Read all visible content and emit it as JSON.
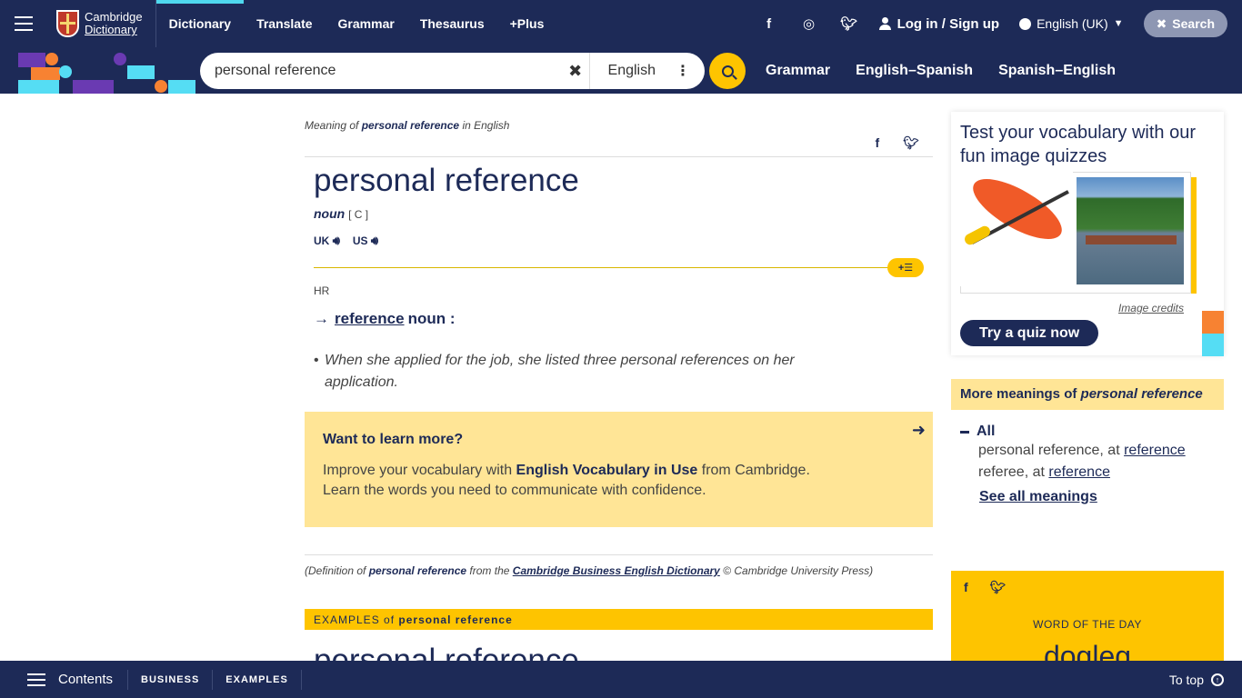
{
  "topnav": {
    "logo_line1": "Cambridge",
    "logo_line2": "Dictionary",
    "links": [
      "Dictionary",
      "Translate",
      "Grammar",
      "Thesaurus",
      "+Plus"
    ],
    "login": "Log in / Sign up",
    "language": "English (UK)",
    "search_label": "Search"
  },
  "searchbar": {
    "query": "personal reference",
    "dictionary": "English",
    "links": [
      "Grammar",
      "English–Spanish",
      "Spanish–English"
    ]
  },
  "entry": {
    "meaning_prefix": "Meaning of ",
    "meaning_word": "personal reference",
    "meaning_suffix": " in English",
    "headword": "personal reference",
    "pos": "noun",
    "grammar": "[ C ]",
    "uk": "UK",
    "us": "US",
    "field": "HR",
    "xref_arrow": "→",
    "xref_word": "reference",
    "xref_pos": "noun :",
    "example": "When she applied for the job, she listed three personal references on her application."
  },
  "learn_more": {
    "title": "Want to learn more?",
    "body_1": "Improve your vocabulary with ",
    "body_bold": "English Vocabulary in Use",
    "body_2": " from Cambridge.",
    "body_3": "Learn the words you need to communicate with confidence."
  },
  "source": {
    "prefix": "(Definition of ",
    "word": "personal reference",
    "middle": " from the ",
    "dictionary": "Cambridge Business English Dictionary",
    "suffix": " © Cambridge University Press)"
  },
  "examples_bar": {
    "label": "EXAMPLES",
    "of": " of ",
    "word": "personal reference"
  },
  "quiz": {
    "title": "Test your vocabulary with our fun image quizzes",
    "credits": "Image credits",
    "button": "Try a quiz now"
  },
  "more_meanings": {
    "title_prefix": "More meanings of ",
    "title_word": "personal reference",
    "all": "All",
    "items": [
      {
        "text": "personal reference, at ",
        "link": "reference"
      },
      {
        "text": "referee, at ",
        "link": "reference"
      }
    ],
    "see_all": "See all meanings"
  },
  "wotd": {
    "label": "WORD OF THE DAY",
    "word": "dogleg"
  },
  "bottombar": {
    "contents": "Contents",
    "links": [
      "BUSINESS",
      "EXAMPLES"
    ],
    "to_top": "To top"
  },
  "colors": {
    "navy": "#1d2a57",
    "yellow": "#fec400",
    "pale_yellow": "#ffe596",
    "cyan": "#55ddf4",
    "orange": "#f78232",
    "purple": "#6a3ab2"
  }
}
